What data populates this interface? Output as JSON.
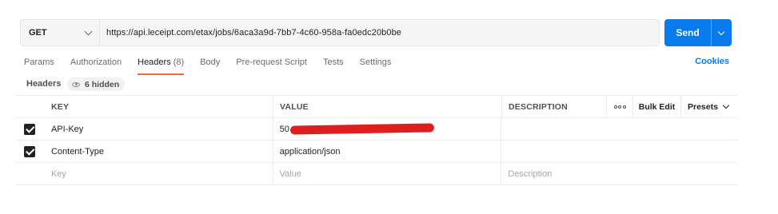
{
  "request": {
    "method": "GET",
    "url": "https://api.leceipt.com/etax/jobs/6aca3a9d-7bb7-4c60-958a-fa0edc20b0be",
    "send_label": "Send"
  },
  "tabs": [
    {
      "label": "Params"
    },
    {
      "label": "Authorization"
    },
    {
      "label": "Headers",
      "count": "(8)",
      "active": true
    },
    {
      "label": "Body"
    },
    {
      "label": "Pre-request Script"
    },
    {
      "label": "Tests"
    },
    {
      "label": "Settings"
    }
  ],
  "cookies_label": "Cookies",
  "headers_section": {
    "label": "Headers",
    "hidden_label": "6 hidden"
  },
  "table": {
    "columns": {
      "key": "KEY",
      "value": "VALUE",
      "description": "DESCRIPTION",
      "bulk_edit": "Bulk Edit",
      "presets": "Presets"
    },
    "rows": [
      {
        "checked": true,
        "key": "API-Key",
        "value": "50",
        "value_redacted": true,
        "description": ""
      },
      {
        "checked": true,
        "key": "Content-Type",
        "value": "application/json",
        "description": ""
      }
    ],
    "new_row": {
      "key_placeholder": "Key",
      "value_placeholder": "Value",
      "description_placeholder": "Description"
    }
  },
  "colors": {
    "accent": "#097bed",
    "active_tab_underline": "#f26b3a",
    "redaction": "#e01e1e"
  }
}
